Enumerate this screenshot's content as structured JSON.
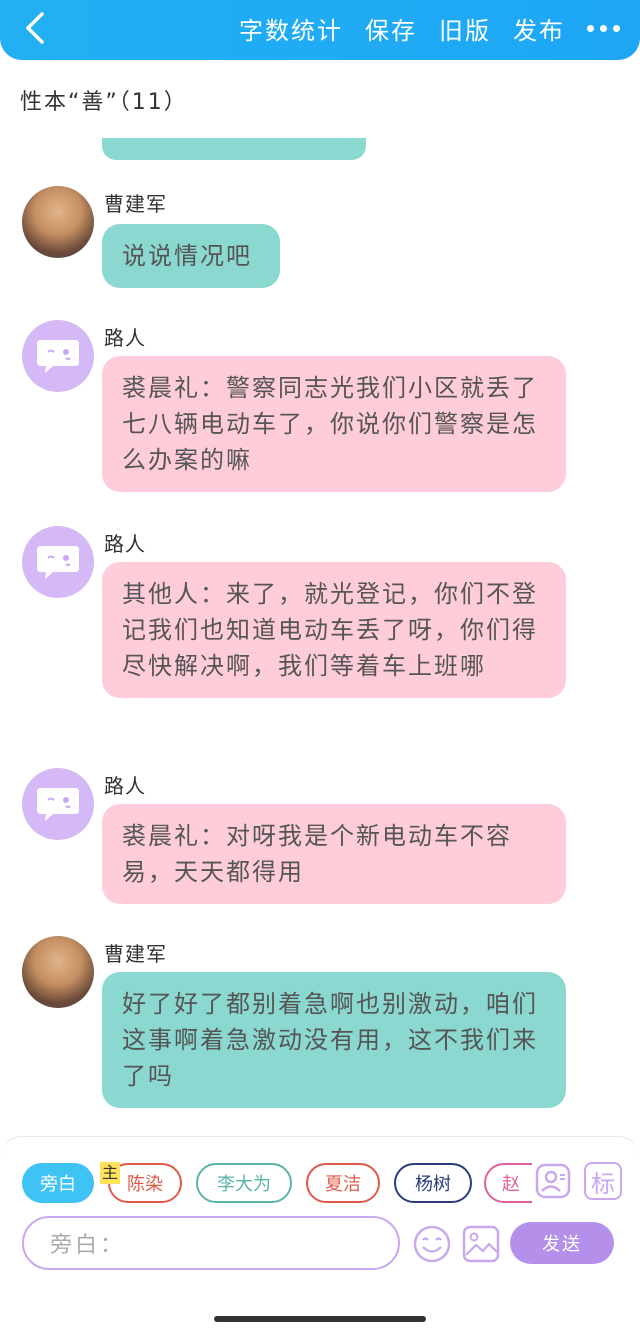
{
  "header": {
    "actions": [
      "字数统计",
      "保存",
      "旧版",
      "发布"
    ]
  },
  "chapter_title": "性本“善”（11）",
  "messages": [
    {
      "speaker": "曹建军",
      "text": "说说情况吧",
      "style": "green"
    },
    {
      "speaker": "路人",
      "text": "裘晨礼：警察同志光我们小区就丢了七八辆电动车了，你说你们警察是怎么办案的嘛",
      "style": "pink"
    },
    {
      "speaker": "路人",
      "text": "其他人：来了，就光登记，你们不登记我们也知道电动车丢了呀，你们得尽快解决啊，我们等着车上班哪",
      "style": "pink"
    },
    {
      "speaker": "路人",
      "text": "裘晨礼：对呀我是个新电动车不容易，天天都得用",
      "style": "pink"
    },
    {
      "speaker": "曹建军",
      "text": "好了好了都别着急啊也别激动，咱们这事啊着急激动没有用，这不我们来了吗",
      "style": "green"
    }
  ],
  "roles": [
    {
      "label": "旁白",
      "active": true,
      "color": "#3fc3f5"
    },
    {
      "label": "陈染",
      "active": false,
      "color": "#e05a4a"
    },
    {
      "label": "李大为",
      "active": false,
      "color": "#59b3a8"
    },
    {
      "label": "夏洁",
      "active": false,
      "color": "#e05a4a"
    },
    {
      "label": "杨树",
      "active": false,
      "color": "#2a3d7a"
    },
    {
      "label": "赵",
      "active": false,
      "color": "#e0609a"
    }
  ],
  "main_tag": "主",
  "side_icons": {
    "role_icon": "person-card-icon",
    "tag_label": "标"
  },
  "composer": {
    "placeholder": "旁白：",
    "send_label": "发送"
  },
  "colors": {
    "header": "#22b0f3",
    "green_bubble": "#8ad8cf",
    "pink_bubble": "#ffcdd9",
    "accent_purple": "#b590ea"
  }
}
